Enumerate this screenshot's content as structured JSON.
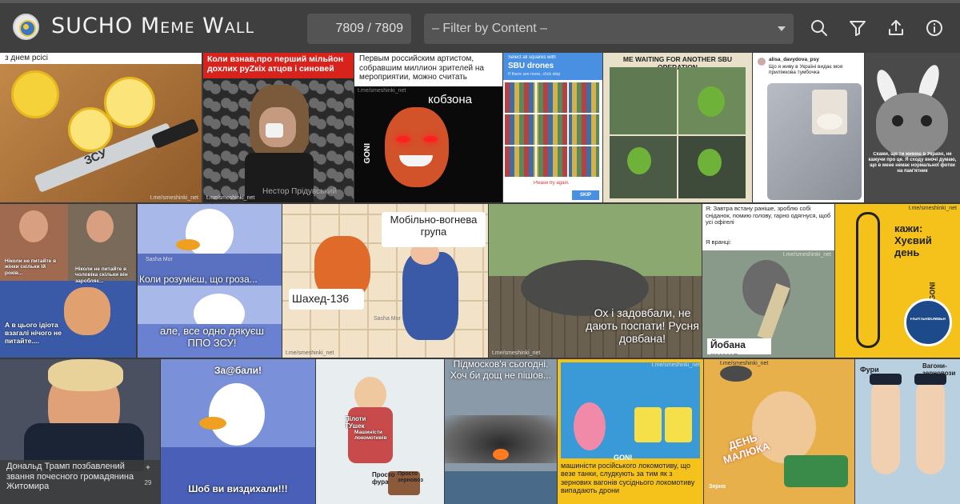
{
  "header": {
    "title": "SUCHO Meme Wall",
    "counter": "7809 / 7809",
    "filter_placeholder": "– Filter by Content –",
    "icons": [
      "search-icon",
      "filter-icon",
      "share-icon",
      "info-icon"
    ]
  },
  "memes": {
    "m1": {
      "top": "з днем рсісі",
      "knife": "ЗСУ",
      "wm": "t.me/smeshinki_net"
    },
    "m2": {
      "top": "Коли взнав,про перший мільйон дохлих руZкіх атцов і синовей",
      "bottom": "Нестор Прідувський",
      "wm": "t.me/smeshinki_net"
    },
    "m3": {
      "top": "Первым российским артистом, собравшим миллион зрителей на мероприятии, можно считать",
      "name": "кобзона",
      "wm": "t.me/smeshinki_net",
      "logo": "GONI"
    },
    "m4": {
      "prompt": "Select all squares with",
      "target": "SBU drones",
      "sub": "If there are none, click skip",
      "retry": "Please try again.",
      "skip": "SKIP"
    },
    "m5": {
      "top": "ME WAITING FOR ANOTHER SBU OPERATION"
    },
    "m6": {
      "user": "alisa_davydova_psy",
      "text": "Що я живу в Україні видає моя приліжкова тумбочка"
    },
    "m7": {
      "text": "Скажи, що ти живеш в Україні, не кажучи про це. Я сходу вночі думаю, що в мене немає нормальної фотки на пам'ятник"
    },
    "m8": {
      "a": "Ніколи не питайте в жінки скільки їй років...",
      "b": "Ніколи не питайте в чоловіка скільки він заробляє...",
      "c": "А в цього ідіота взагалі нічого не питайте....",
      "author": "Sasha Mor"
    },
    "m9": {
      "a": "Коли розумієш, що гроза...",
      "b": "але, все одно дякуєш ППО ЗСУ!",
      "author": "Sasha Mor"
    },
    "m10": {
      "label1": "Мобільно-вогнева група",
      "label2": "Шахед-136",
      "wm": "t.me/smeshinki_net",
      "author": "Sasha Mor"
    },
    "m11": {
      "text": "Ох і задовбали, не дають поспати! Русня довбана!",
      "wm": "t.me/smeshinki_net"
    },
    "m12": {
      "a": "Я: Завтра встану раніше, зроблю собі сніданок, помию голову, гарно одягнуся, щоб усі офігелі",
      "b": "Я вранці:",
      "c": "Йобана русня",
      "wm": "t.me/smeshinki_net"
    },
    "m13": {
      "text": "кажи: Хуєвий день",
      "logo": "GONI",
      "badge": "FIGHTERBOMBER",
      "wm": "t.me/smeshinki_net"
    },
    "m14": {
      "text": "Дональд Трамп позбавлений звання почесного громадянина Житомира",
      "plus": "+",
      "count": "29",
      "wm": "t.me/smeshinki_net"
    },
    "m15": {
      "top": "За@бали!",
      "bottom": "Шоб ви виздихали!!!"
    },
    "m16": {
      "a": "Пілоти ТУшек",
      "b": "Машиністи локомотивів",
      "c": "Просто фура",
      "d": "Просто зерновоз"
    },
    "m17": {
      "text": "Підмосков'я сьогодні. Хоч би дощ не пішов..."
    },
    "m18": {
      "text": "машиністи російського локомотиву, що везе танки, слудкують за тим як з зернових вагонів сусіднього локомотиву випадають дрони",
      "logo": "GONI",
      "wm": "t.me/smeshinki_net"
    },
    "m19": {
      "text": "ДЕНЬ МАЛЮКА",
      "sub": "Зерно",
      "wm": "t.me/smeshinki_net"
    },
    "m20": {
      "a": "Фури",
      "b": "Вагони-зерновози"
    }
  }
}
